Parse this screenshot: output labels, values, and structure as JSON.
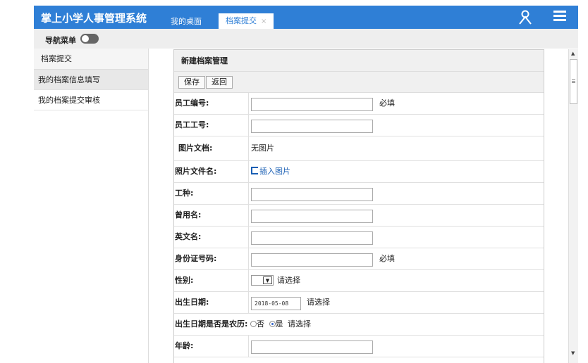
{
  "app": {
    "title": "掌上小学人事管理系统"
  },
  "tabs": {
    "home": "我的桌面",
    "active": "档案提交",
    "close": "×"
  },
  "nav": {
    "label": "导航菜单"
  },
  "sidebar": {
    "header": "档案提交",
    "items": [
      {
        "label": "我的档案信息填写"
      },
      {
        "label": "我的档案提交审核"
      }
    ]
  },
  "panel": {
    "title": "新建档案管理",
    "save": "保存",
    "back": "返回"
  },
  "form": {
    "required": "必填",
    "please_select": "请选择",
    "emp_no": "员工编号:",
    "emp_id": "员工工号:",
    "pic_doc": "图片文档:",
    "pic_doc_value": "无图片",
    "photo": "照片文件名:",
    "insert_pic": "插入图片",
    "job": "工种:",
    "former_name": "曾用名:",
    "en_name": "英文名:",
    "id_card": "身份证号码:",
    "gender": "性别:",
    "birth": "出生日期:",
    "birth_value": "2018-05-08",
    "lunar": "出生日期是否是农历:",
    "lunar_no": "否",
    "lunar_yes": "是",
    "age": "年龄:"
  }
}
